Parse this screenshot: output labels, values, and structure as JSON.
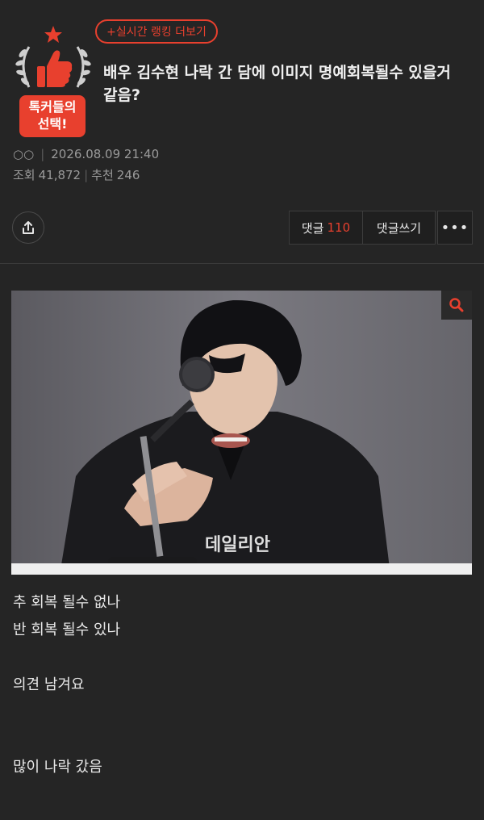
{
  "header": {
    "ranking_button": "+실시간 랭킹 더보기",
    "badge_line1": "톡커들의",
    "badge_line2": "선택!"
  },
  "post": {
    "title": "배우 김수현 나락 간 담에 이미지 명예회복될수 있을거 같음?",
    "author": "○○",
    "date": "2026.08.09 21:40",
    "views_label": "조회",
    "views": "41,872",
    "likes_label": "추천",
    "likes": "246"
  },
  "actions": {
    "comments_label": "댓글",
    "comments_count": "110",
    "write_comment": "댓글쓰기",
    "more": "•••"
  },
  "image": {
    "watermark": "데일리안"
  },
  "body": {
    "line1": "추 회복 될수 없나",
    "line2": "반 회복 될수 있나",
    "line3": "의견 남겨요",
    "line4": "많이 나락 갔음"
  },
  "colors": {
    "accent": "#e8402e",
    "background": "#252525"
  }
}
